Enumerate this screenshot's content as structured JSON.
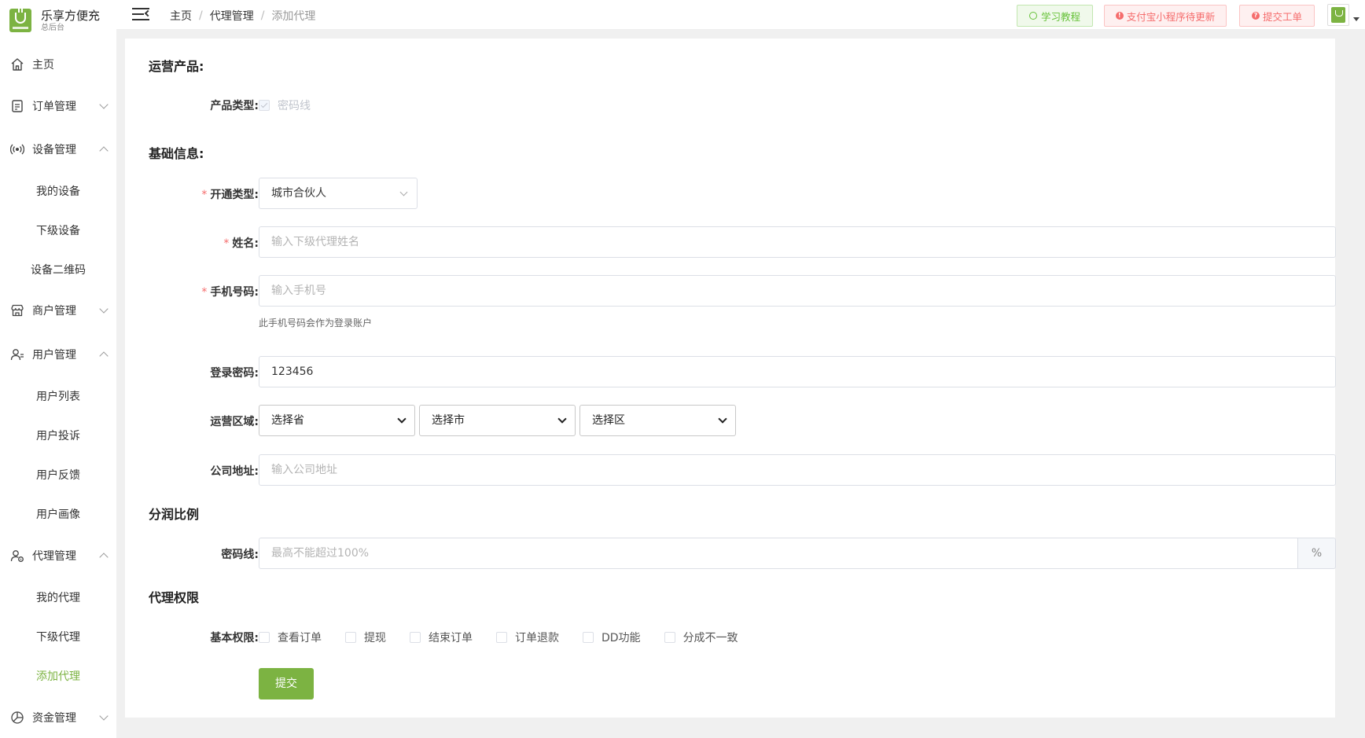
{
  "brand": {
    "name": "乐享方便充",
    "subtitle": "总后台"
  },
  "sidebar": {
    "home": "主页",
    "orders": "订单管理",
    "devices": "设备管理",
    "device_items": [
      "我的设备",
      "下级设备",
      "设备二维码"
    ],
    "merchants": "商户管理",
    "users": "用户管理",
    "user_items": [
      "用户列表",
      "用户投诉",
      "用户反馈",
      "用户画像"
    ],
    "agents": "代理管理",
    "agent_items": [
      "我的代理",
      "下级代理",
      "添加代理"
    ],
    "funds": "资金管理",
    "active_item": "添加代理"
  },
  "header": {
    "breadcrumb": [
      "主页",
      "代理管理",
      "添加代理"
    ],
    "breadcrumb_sep": "/",
    "btn_tutorial": "学习教程",
    "btn_alipay": "支付宝小程序待更新",
    "btn_ticket": "提交工单",
    "alert_glyph": "!",
    "question_glyph": "?"
  },
  "form": {
    "section_product": "运营产品:",
    "product_type_label": "产品类型:",
    "product_type_option": "密码线",
    "section_basic": "基础信息:",
    "open_type_label": "开通类型:",
    "open_type_value": "城市合伙人",
    "required_mark": "*",
    "name_label": "姓名:",
    "name_placeholder": "输入下级代理姓名",
    "phone_label": "手机号码:",
    "phone_placeholder": "输入手机号",
    "phone_hint": "此手机号码会作为登录账户",
    "password_label": "登录密码:",
    "password_value": "123456",
    "region_label": "运营区域:",
    "province_placeholder": "选择省",
    "city_placeholder": "选择市",
    "district_placeholder": "选择区",
    "address_label": "公司地址:",
    "address_placeholder": "输入公司地址",
    "section_share": "分润比例",
    "share_label": "密码线:",
    "share_placeholder": "最高不能超过100%",
    "share_unit": "%",
    "section_perm": "代理权限",
    "perm_label": "基本权限:",
    "perm_options": [
      "查看订单",
      "提现",
      "结束订单",
      "订单退款",
      "DD功能",
      "分成不一致"
    ],
    "submit": "提交"
  },
  "colors": {
    "brand_green": "#7cb342",
    "danger": "#f56c6c",
    "success": "#67c23a"
  }
}
